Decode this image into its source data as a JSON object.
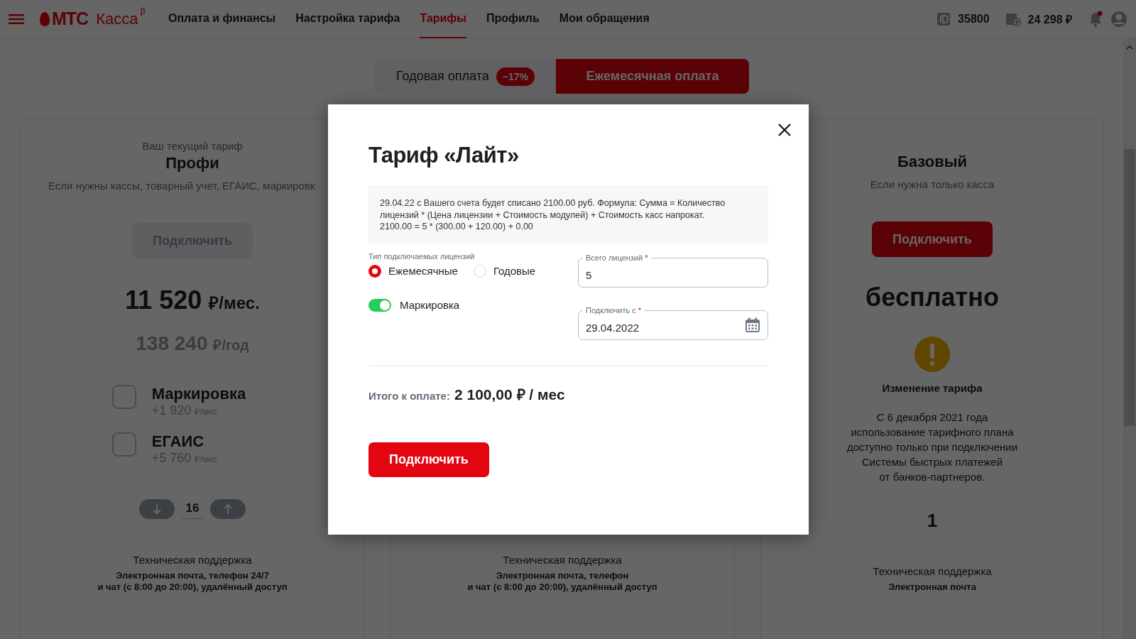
{
  "header": {
    "logo": {
      "brand": "МТС",
      "product": "Касса",
      "mark": "β"
    },
    "nav": [
      {
        "label": "Оплата и финансы",
        "selected": false
      },
      {
        "label": "Настройка тарифа",
        "selected": false
      },
      {
        "label": "Тарифы",
        "selected": true
      },
      {
        "label": "Профиль",
        "selected": false
      },
      {
        "label": "Мои обращения",
        "selected": false
      }
    ],
    "account_id": "35800",
    "balance": "24 298 ₽",
    "notifications_unread": true
  },
  "billing_toggle": [
    {
      "label": "Годовая оплата",
      "badge": "−17%",
      "selected": false
    },
    {
      "label": "Ежемесячная оплата",
      "selected": true
    }
  ],
  "plans": [
    {
      "caption": "Ваш текущий тариф",
      "name": "Профи",
      "description": "Если нужны кассы, товарный учет, ЕГАИС, маркировк",
      "button": {
        "label": "Подключить",
        "disabled": true
      },
      "price": "11 520",
      "price_unit": "₽/мес.",
      "year_price": "138 240",
      "year_unit": "₽/год",
      "addons": [
        {
          "name": "Маркировка",
          "price": "+1 920",
          "unit": "₽/мес.",
          "checked": false
        },
        {
          "name": "ЕГАИС",
          "price": "+5 760",
          "unit": "₽/мес.",
          "checked": false
        }
      ],
      "count": "16",
      "support_title": "Техническая поддержка",
      "support_text": "Электронная почта, телефон 24/7\nи чат (с 8:00 до 20:00), удалённый доступ"
    },
    {
      "support_title": "Техническая поддержка",
      "support_text": "Электронная почта, телефон\nи чат (с 8:00 до 20:00), удалённый доступ"
    },
    {
      "name": "Базовый",
      "description": "Если нужна только касса",
      "button": {
        "label": "Подключить",
        "disabled": false
      },
      "price": "бесплатно",
      "notice_title": "Изменение тарифа",
      "notice_text": "С 6 декабря 2021 года\nиспользование тарифного плана\nдоступно только при подключении\nСистемы быстрых платежей\nот банков-партнеров.",
      "count": "1",
      "support_title": "Техническая поддержка",
      "support_text": "Электронная почта"
    }
  ],
  "modal": {
    "title": "Тариф «Лайт»",
    "info": "29.04.22 с Вашего счета будет списано 2100.00 руб. Формула: Сумма = Количество\nлицензий * (Цена лицензии + Стоимость модулей) + Стоимость касс напрокат.\n2100.00 = 5 * (300.00 + 120.00) + 0.00",
    "license_type_label": "Тип подключаемых лицензий",
    "license_types": [
      {
        "label": "Ежемесячные",
        "selected": true
      },
      {
        "label": "Годовые",
        "selected": false
      }
    ],
    "toggle": {
      "label": "Маркировка",
      "on": true
    },
    "fields": [
      {
        "kind": "number",
        "label": "Всего лицензий",
        "required_mark": "*",
        "value": "5"
      },
      {
        "kind": "date",
        "label": "Подключить с",
        "required_mark": "*",
        "value": "29.04.2022"
      }
    ],
    "total_label": "Итого к оплате:",
    "total_value": "2 100,00 ₽ / мес",
    "button": "Подключить"
  }
}
